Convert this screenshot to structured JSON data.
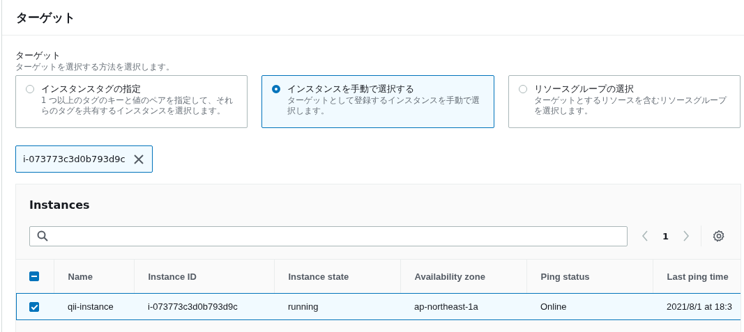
{
  "panel": {
    "title": "ターゲット"
  },
  "target": {
    "label": "ターゲット",
    "description": "ターゲットを選択する方法を選択します。",
    "options": [
      {
        "title": "インスタンスタグの指定",
        "description": "1 つ以上のタグのキーと値のペアを指定して、それらのタグを共有するインスタンスを選択します。",
        "selected": false
      },
      {
        "title": "インスタンスを手動で選択する",
        "description": "ターゲットとして登録するインスタンスを手動で選択します。",
        "selected": true
      },
      {
        "title": "リソースグループの選択",
        "description": "ターゲットとするリソースを含むリソースグループを選択します。",
        "selected": false
      }
    ]
  },
  "tokens": [
    {
      "label": "i-073773c3d0b793d9c"
    }
  ],
  "table": {
    "title": "Instances",
    "pagination": {
      "page": "1"
    },
    "select_all": {
      "indeterminate": true
    },
    "columns": [
      "Name",
      "Instance ID",
      "Instance state",
      "Availability zone",
      "Ping status",
      "Last ping time"
    ],
    "rows": [
      {
        "selected": true,
        "cells": [
          "qii-instance",
          "i-073773c3d0b793d9c",
          "running",
          "ap-northeast-1a",
          "Online",
          "2021/8/1 at 18:3"
        ]
      }
    ]
  }
}
